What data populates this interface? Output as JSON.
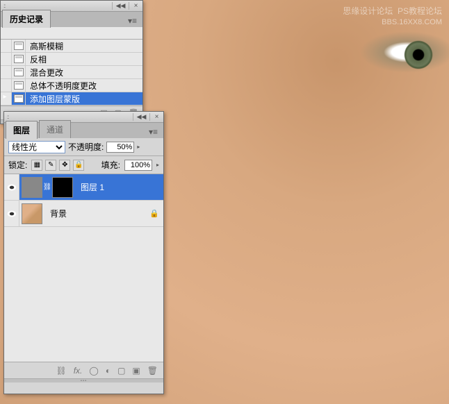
{
  "watermark": {
    "line1": "思缘设计论坛",
    "line1b": "PS教程论坛",
    "line2": "BBS.16XX8.COM"
  },
  "history": {
    "title": "历史记录",
    "items": [
      {
        "label": "高斯模糊"
      },
      {
        "label": "反相"
      },
      {
        "label": "混合更改"
      },
      {
        "label": "总体不透明度更改"
      },
      {
        "label": "添加图层蒙版"
      }
    ]
  },
  "layers": {
    "tabs": {
      "main": "图层",
      "channels": "通道"
    },
    "blend_mode": "线性光",
    "opacity_label": "不透明度:",
    "opacity": "50%",
    "lock_label": "锁定:",
    "fill_label": "填充:",
    "fill": "100%",
    "items": [
      {
        "name": "图层 1"
      },
      {
        "name": "背景"
      }
    ]
  }
}
